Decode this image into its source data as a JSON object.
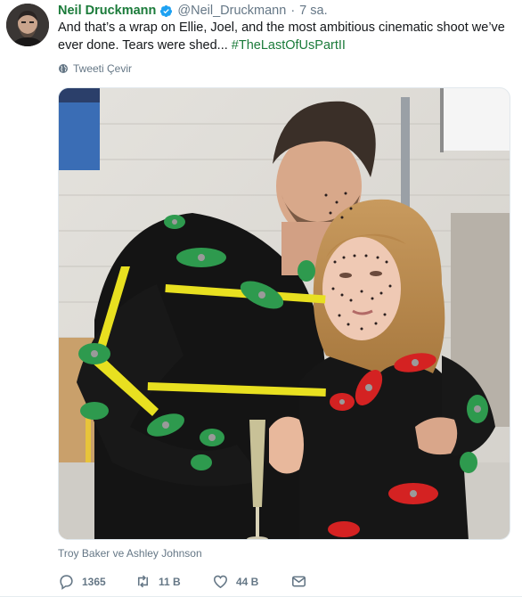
{
  "tweet": {
    "author_name": "Neil Druckmann",
    "handle": "@Neil_Druckmann",
    "separator": "·",
    "time": "7 sa.",
    "text": "And that’s a wrap on Ellie, Joel, and the most ambitious cinematic shoot we’ve ever done. Tears were shed... ",
    "hashtag": "#TheLastOfUsPartII",
    "translate_label": "Tweeti Çevir",
    "photo_caption": "Troy Baker ve Ashley Johnson",
    "reply_count": "1365",
    "retweet_count": "11 B",
    "like_count": "44 B"
  },
  "icons": {
    "verified": "verified-badge-icon",
    "globe": "globe-icon",
    "reply": "reply-icon",
    "retweet": "retweet-icon",
    "like": "heart-icon",
    "dm": "direct-message-icon"
  },
  "colors": {
    "link_accent": "#1b7b3a",
    "verified_blue": "#1da1f2",
    "muted": "#657786"
  }
}
